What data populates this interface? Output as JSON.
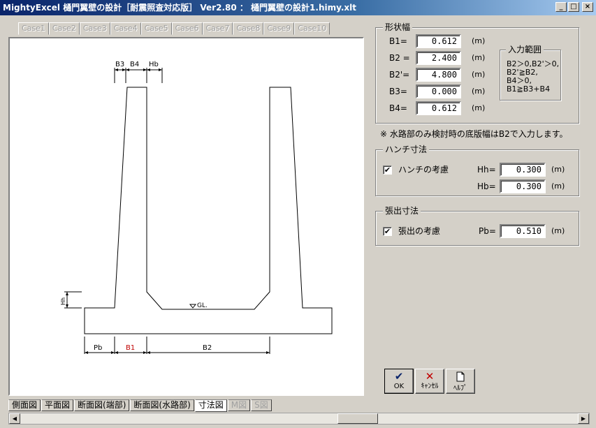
{
  "window": {
    "title": "MightyExcel 樋門翼壁の設計［耐震照査対応版］ Ver2.80 ： 樋門翼壁の設計1.himy.xlt",
    "minimize": "_",
    "maximize": "□",
    "close": "×"
  },
  "case_tabs": [
    "Case1",
    "Case2",
    "Case3",
    "Case4",
    "Case5",
    "Case6",
    "Case7",
    "Case8",
    "Case9",
    "Case10"
  ],
  "drawing": {
    "labels": {
      "b3": "B3",
      "b4": "B4",
      "hb": "Hb",
      "hh": "Hh",
      "gl": "GL.",
      "pb": "Pb",
      "b1": "B1",
      "b2": "B2"
    },
    "b1_color": "#c00000"
  },
  "sheet_tabs": [
    {
      "label": "側面図",
      "state": "normal"
    },
    {
      "label": "平面図",
      "state": "normal"
    },
    {
      "label": "断面図(端部)",
      "state": "normal"
    },
    {
      "label": "断面図(水路部)",
      "state": "normal"
    },
    {
      "label": "寸法図",
      "state": "active"
    },
    {
      "label": "M図",
      "state": "disabled"
    },
    {
      "label": "S図",
      "state": "disabled"
    }
  ],
  "shape_width": {
    "title": "形状幅",
    "rows": [
      {
        "label": "B1=",
        "value": "0.612",
        "unit": "(m)"
      },
      {
        "label": "B2 =",
        "value": "2.400",
        "unit": "(m)"
      },
      {
        "label": "B2'=",
        "value": "4.800",
        "unit": "(m)"
      },
      {
        "label": "B3=",
        "value": "0.000",
        "unit": "(m)"
      },
      {
        "label": "B4=",
        "value": "0.612",
        "unit": "(m)"
      }
    ],
    "range": {
      "title": "入力範囲",
      "lines": [
        "B2＞0,B2'＞0,",
        "B2'≧B2,",
        "B4＞0,",
        "B1≧B3+B4"
      ]
    }
  },
  "note": "※ 水路部のみ検討時の底版幅はB2で入力します。",
  "haunch": {
    "title": "ハンチ寸法",
    "check_label": "ハンチの考慮",
    "checked": true,
    "hh_label": "Hh=",
    "hh_value": "0.300",
    "hb_label": "Hb=",
    "hb_value": "0.300",
    "unit": "(m)"
  },
  "overhang": {
    "title": "張出寸法",
    "check_label": "張出の考慮",
    "checked": true,
    "pb_label": "Pb=",
    "pb_value": "0.510",
    "unit": "(m)"
  },
  "buttons": {
    "ok": {
      "label": "OK",
      "icon": "checkmark-icon",
      "color": "#0a246a"
    },
    "cancel": {
      "label": "ｷｬﾝｾﾙ",
      "icon": "cross-icon",
      "color": "#c00000"
    },
    "help": {
      "label": "ﾍﾙﾌﾟ",
      "icon": "document-icon"
    }
  },
  "check_mark": "✔"
}
